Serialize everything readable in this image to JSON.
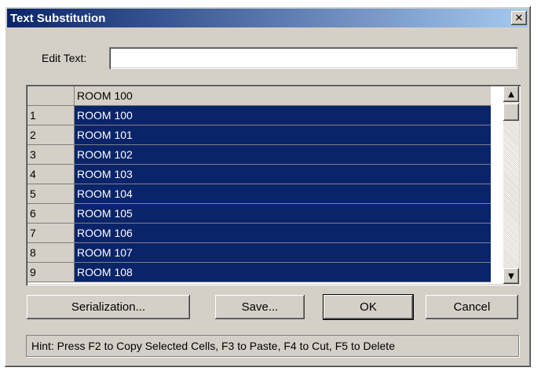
{
  "window": {
    "title": "Text Substitution",
    "close_glyph": "✕"
  },
  "edit": {
    "label": "Edit Text:",
    "value": ""
  },
  "grid": {
    "header": {
      "row_label": "",
      "value": "ROOM 100"
    },
    "rows": [
      {
        "label": "1",
        "value": "ROOM 100"
      },
      {
        "label": "2",
        "value": "ROOM 101"
      },
      {
        "label": "3",
        "value": "ROOM 102"
      },
      {
        "label": "4",
        "value": "ROOM 103"
      },
      {
        "label": "5",
        "value": "ROOM 104"
      },
      {
        "label": "6",
        "value": "ROOM 105"
      },
      {
        "label": "7",
        "value": "ROOM 106"
      },
      {
        "label": "8",
        "value": "ROOM 107"
      },
      {
        "label": "9",
        "value": "ROOM 108"
      }
    ],
    "scroll_up_glyph": "▲",
    "scroll_down_glyph": "▼"
  },
  "buttons": {
    "serialization": "Serialization...",
    "save": "Save...",
    "ok": "OK",
    "cancel": "Cancel"
  },
  "hint": "Hint: Press F2 to Copy Selected Cells, F3 to Paste, F4 to Cut, F5 to Delete",
  "colors": {
    "title_start": "#0a246a",
    "title_end": "#a6caf0",
    "selection": "#0a246a",
    "face": "#d4d0c8"
  }
}
